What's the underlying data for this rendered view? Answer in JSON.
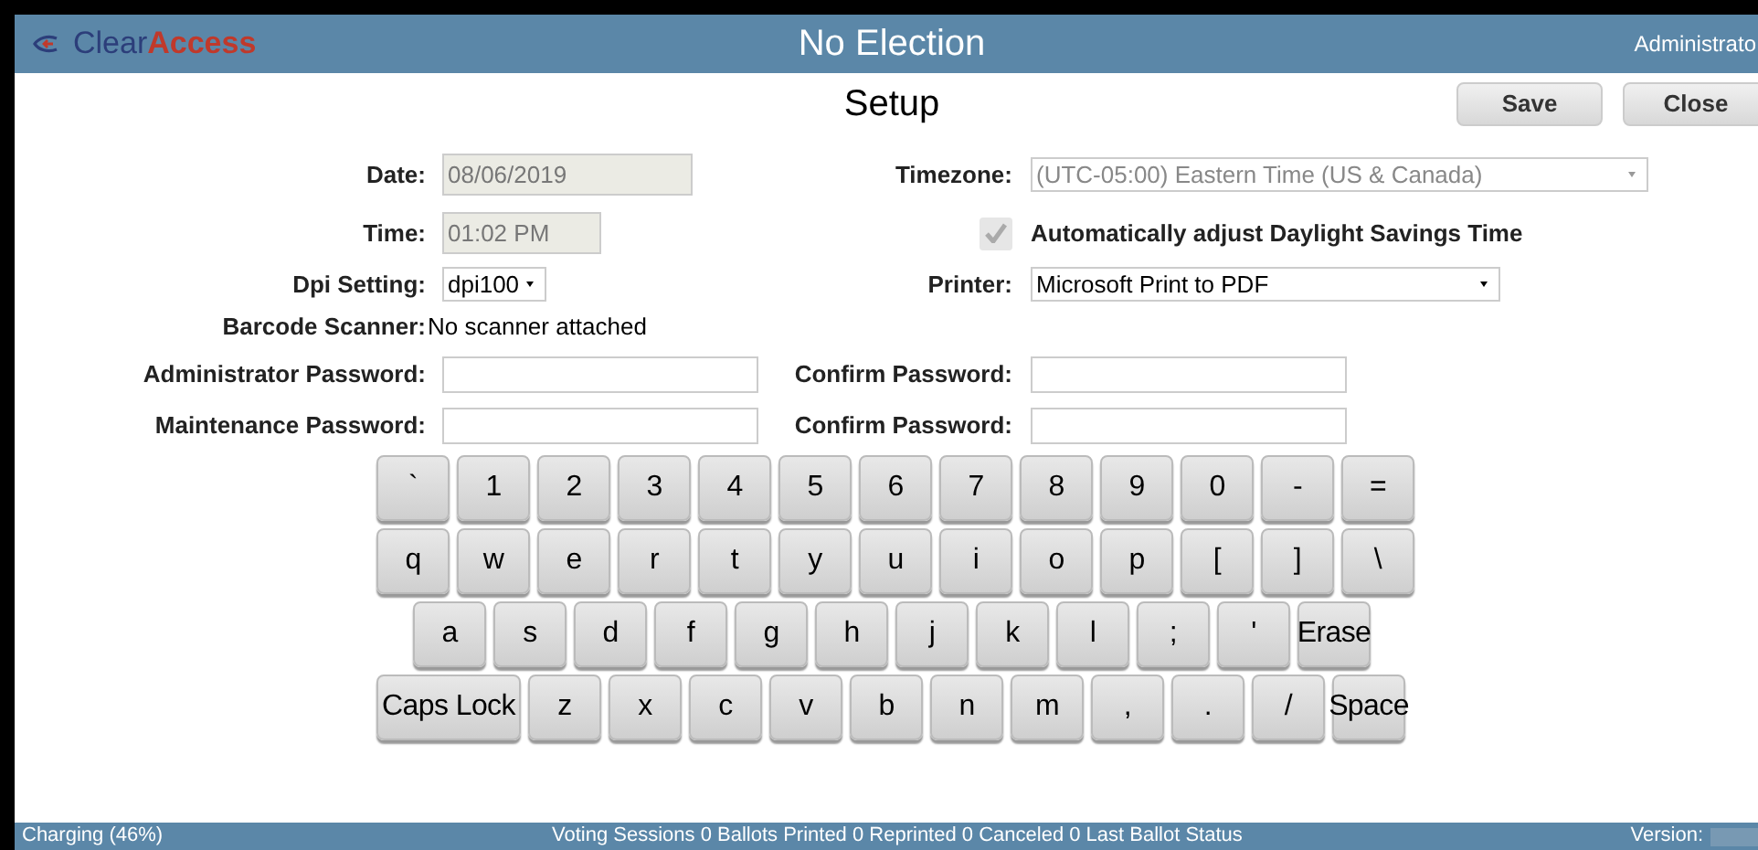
{
  "header": {
    "logo_plain": "Clear",
    "logo_bold": "Access",
    "title": "No Election",
    "user": "Administrato"
  },
  "page": {
    "title": "Setup",
    "buttons": [
      "Save",
      "Close"
    ]
  },
  "form": {
    "date": {
      "label": "Date:",
      "value": "08/06/2019",
      "disabled": true
    },
    "timezone": {
      "label": "Timezone:",
      "value": "(UTC-05:00) Eastern Time (US & Canada)",
      "disabled": true
    },
    "time": {
      "label": "Time:",
      "value": "01:02 PM",
      "disabled": true
    },
    "dst": {
      "label": "Automatically adjust Daylight Savings Time",
      "checked": true,
      "disabled": true
    },
    "dpi": {
      "label": "Dpi Setting:",
      "value": "dpi100"
    },
    "printer": {
      "label": "Printer:",
      "value": "Microsoft Print to PDF",
      "disabled": false
    },
    "scanner": {
      "label": "Barcode Scanner:",
      "value": "No scanner attached"
    },
    "passwords": [
      {
        "label": "Administrator Password:",
        "confirm_label": "Confirm Password:"
      },
      {
        "label": "Maintenance Password:",
        "confirm_label": "Confirm Password:"
      }
    ]
  },
  "keyboard": [
    [
      "`",
      "1",
      "2",
      "3",
      "4",
      "5",
      "6",
      "7",
      "8",
      "9",
      "0",
      "-",
      "="
    ],
    [
      "q",
      "w",
      "e",
      "r",
      "t",
      "y",
      "u",
      "i",
      "o",
      "p",
      "[",
      "]",
      "\\"
    ],
    [
      "a",
      "s",
      "d",
      "f",
      "g",
      "h",
      "j",
      "k",
      "l",
      ";",
      "'",
      "Erase"
    ],
    [
      "Caps Lock",
      "z",
      "x",
      "c",
      "v",
      "b",
      "n",
      "m",
      ",",
      ".",
      "/",
      "Space"
    ]
  ],
  "status_bar": {
    "left": "Charging (46%)",
    "center": "Voting Sessions 0 Ballots Printed 0 Reprinted 0 Canceled 0 Last Ballot Status",
    "right": "Version:"
  }
}
